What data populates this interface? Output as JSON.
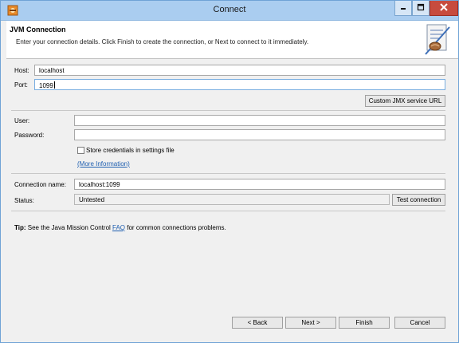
{
  "window": {
    "title": "Connect"
  },
  "header": {
    "title": "JVM Connection",
    "description": "Enter your connection details. Click Finish to create the connection, or Next to connect to it immediately."
  },
  "form": {
    "host_label": "Host:",
    "host_value": "localhost",
    "port_label": "Port:",
    "port_value": "1099",
    "custom_jmx_button": "Custom JMX service URL",
    "user_label": "User:",
    "user_value": "",
    "password_label": "Password:",
    "password_value": "",
    "store_credentials_label": "Store credentials in settings file",
    "store_credentials_checked": false,
    "more_info_link": "(More Information)",
    "connection_name_label": "Connection name:",
    "connection_name_value": "localhost:1099",
    "status_label": "Status:",
    "status_value": "Untested",
    "test_connection_button": "Test connection"
  },
  "tip": {
    "prefix": "Tip:",
    "text_before": " See the Java Mission Control ",
    "link": "FAQ",
    "text_after": " for common connections problems."
  },
  "footer": {
    "back_button": "< Back",
    "next_button": "Next >",
    "finish_button": "Finish",
    "cancel_button": "Cancel"
  },
  "icons": {
    "app": "eclipse-app-icon",
    "header_art": "jvm-connection-wizard-icon",
    "minimize": "minimize-icon",
    "maximize": "maximize-icon",
    "close": "close-icon"
  }
}
